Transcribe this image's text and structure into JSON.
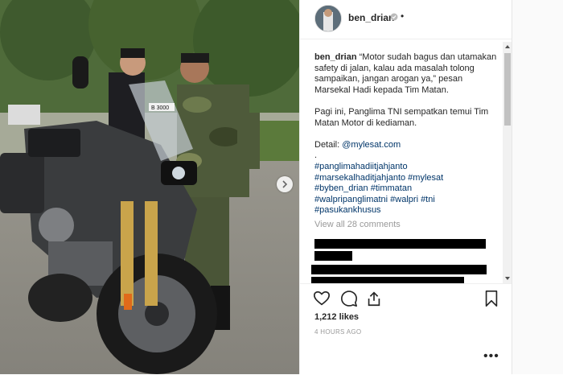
{
  "post": {
    "username": "ben_drian",
    "more_dots": "•",
    "caption_user": "ben_drian",
    "caption_line1": " “Motor sudah bagus dan utamakan safety di jalan, kalau ada masalah tolong sampaikan, jangan arogan ya,” pesan Marsekal Hadi kepada Tim Matan.",
    "caption_line2": "Pagi ini, Panglima TNI sempatkan temui Tim Matan Motor di kediaman.",
    "detail_label": "Detail: ",
    "detail_link": "@mylesat.com",
    "separator": ".",
    "hashtags": [
      "#panglimahadiitjahjanto",
      "#marsekalhaditjahjanto #mylesat",
      "#byben_drian #timmatan",
      "#walpripanglimatni #walpri #tni",
      "#pasukankhusus"
    ],
    "view_all": "View all 28 comments",
    "likes": "1,212 likes",
    "time": "4 HOURS AGO",
    "more_label": "•••"
  },
  "icons": {
    "like": "heart-icon",
    "comment": "comment-icon",
    "share": "share-icon",
    "save": "bookmark-icon",
    "verified": "verified-icon",
    "next": "chevron-right-icon"
  },
  "photo": {
    "plate": "B 3000"
  },
  "colors": {
    "link": "#003569",
    "muted": "#999999",
    "text": "#262626"
  }
}
